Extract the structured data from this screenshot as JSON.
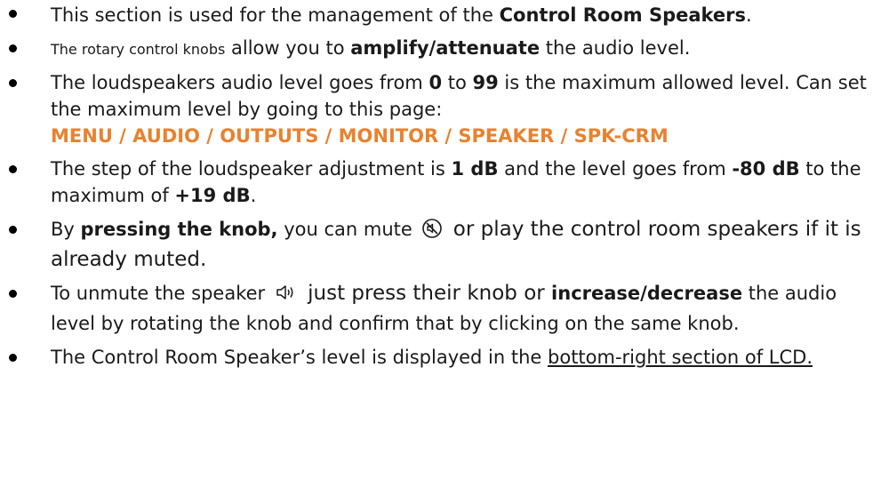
{
  "bullets": {
    "b1": {
      "t1": "This section is used for the management of the ",
      "b": "Control Room Speakers",
      "t2": "."
    },
    "b2": {
      "small": "The rotary control knobs",
      "t1": " allow you to ",
      "b": "amplify/attenuate",
      "t2": " the audio level."
    },
    "b3": {
      "t1": "The loudspeakers audio level goes from ",
      "b1": "0",
      "t2": " to ",
      "b2": "99",
      "t3": " is the maximum allowed level. Can set the maximum level by going to this page:",
      "path": "MENU / AUDIO / OUTPUTS / MONITOR / SPEAKER / SPK-CRM"
    },
    "b4": {
      "t1": "The step of the loudspeaker adjustment is ",
      "b1": "1 dB",
      "t2": " and the level goes from ",
      "b2": "-80 dB",
      "t3": " to the maximum of ",
      "b3": "+19 dB",
      "t4": "."
    },
    "b5": {
      "t1": "By ",
      "b": "pressing the knob,",
      "t2": " you can mute ",
      "t3": " or play the control room speakers if it is already muted."
    },
    "b6": {
      "t1": "To unmute the speaker ",
      "t2": " just press their knob or ",
      "b": "increase/decrease",
      "t3": " the audio level by rotating the knob and confirm that by clicking on the same knob."
    },
    "b7": {
      "t1": "The Control Room Speaker’s level is displayed in the ",
      "u": "bottom-right section of LCD."
    }
  },
  "icons": {
    "mute": "speaker-muted-icon",
    "unmute": "speaker-unmuted-icon"
  },
  "colors": {
    "path": "#e8822f",
    "text": "#1a1a1a"
  }
}
